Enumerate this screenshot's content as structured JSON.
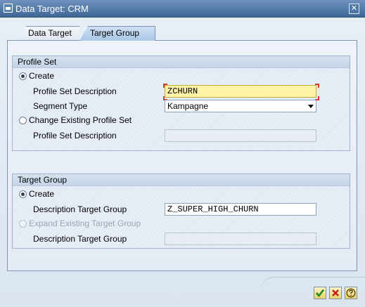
{
  "window": {
    "title": "Data Target: CRM",
    "close_glyph": "✕",
    "app_icon": "dialog-icon"
  },
  "tabs": [
    {
      "label": "Data Target"
    },
    {
      "label": "Target Group"
    }
  ],
  "profile_set": {
    "heading": "Profile Set",
    "create_label": "Create",
    "profile_set_description_label": "Profile Set Description",
    "profile_set_description_value": "ZCHURN",
    "segment_type_label": "Segment Type",
    "segment_type_value": "Kampagne",
    "change_existing_label": "Change Existing Profile Set",
    "existing_description_label": "Profile Set Description",
    "existing_description_value": ""
  },
  "target_group": {
    "heading": "Target Group",
    "create_label": "Create",
    "description_label": "Description Target Group",
    "description_value": "Z_SUPER_HIGH_CHURN",
    "expand_existing_label": "Expand Existing Target Group",
    "existing_description_label": "Description Target Group",
    "existing_description_value": ""
  },
  "buttons": {
    "confirm_icon": "checkmark-icon",
    "cancel_icon": "cancel-icon",
    "help_icon": "help-icon"
  },
  "colors": {
    "title_bar": "#3f6796",
    "active_field": "#fff4a8"
  }
}
